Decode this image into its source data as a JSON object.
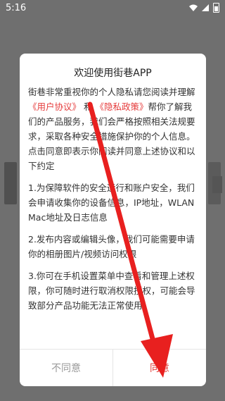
{
  "status_bar": {
    "time": "5:16"
  },
  "dialog": {
    "title": "欢迎使用街巷APP",
    "intro_before": "街巷非常重视你的个人隐私请您阅读并理解",
    "user_agreement": "《用户协议》",
    "intro_and": "和",
    "privacy_policy": "《隐私政策》",
    "intro_after": "帮你了解我们的产品服务，我们会严格按照相关法规要求，采取各种安全措施保护你的个人信息。",
    "consent_line": "点击同意即表示你阅读并同意上述协议和以下约定",
    "items": [
      "1.为保障软件的安全运行和账户安全，我们会申请收集你的设备信息，IP地址，WLAN Mac地址及日志信息",
      "2.发布内容或编辑头像，我们可能需要申请你的相册图片/视频访问权限",
      "3.你可在手机设置菜单中查看和管理上述权限，你可随时进行取消权限授权，可能会导致部分产品功能无法正常使用"
    ],
    "disagree_label": "不同意",
    "agree_label": "同意"
  },
  "colors": {
    "link": "#e53b3b",
    "agree": "#e53935",
    "disagree": "#9a9a9a",
    "arrow": "#e8201f",
    "overlay": "#6f6f6f"
  }
}
